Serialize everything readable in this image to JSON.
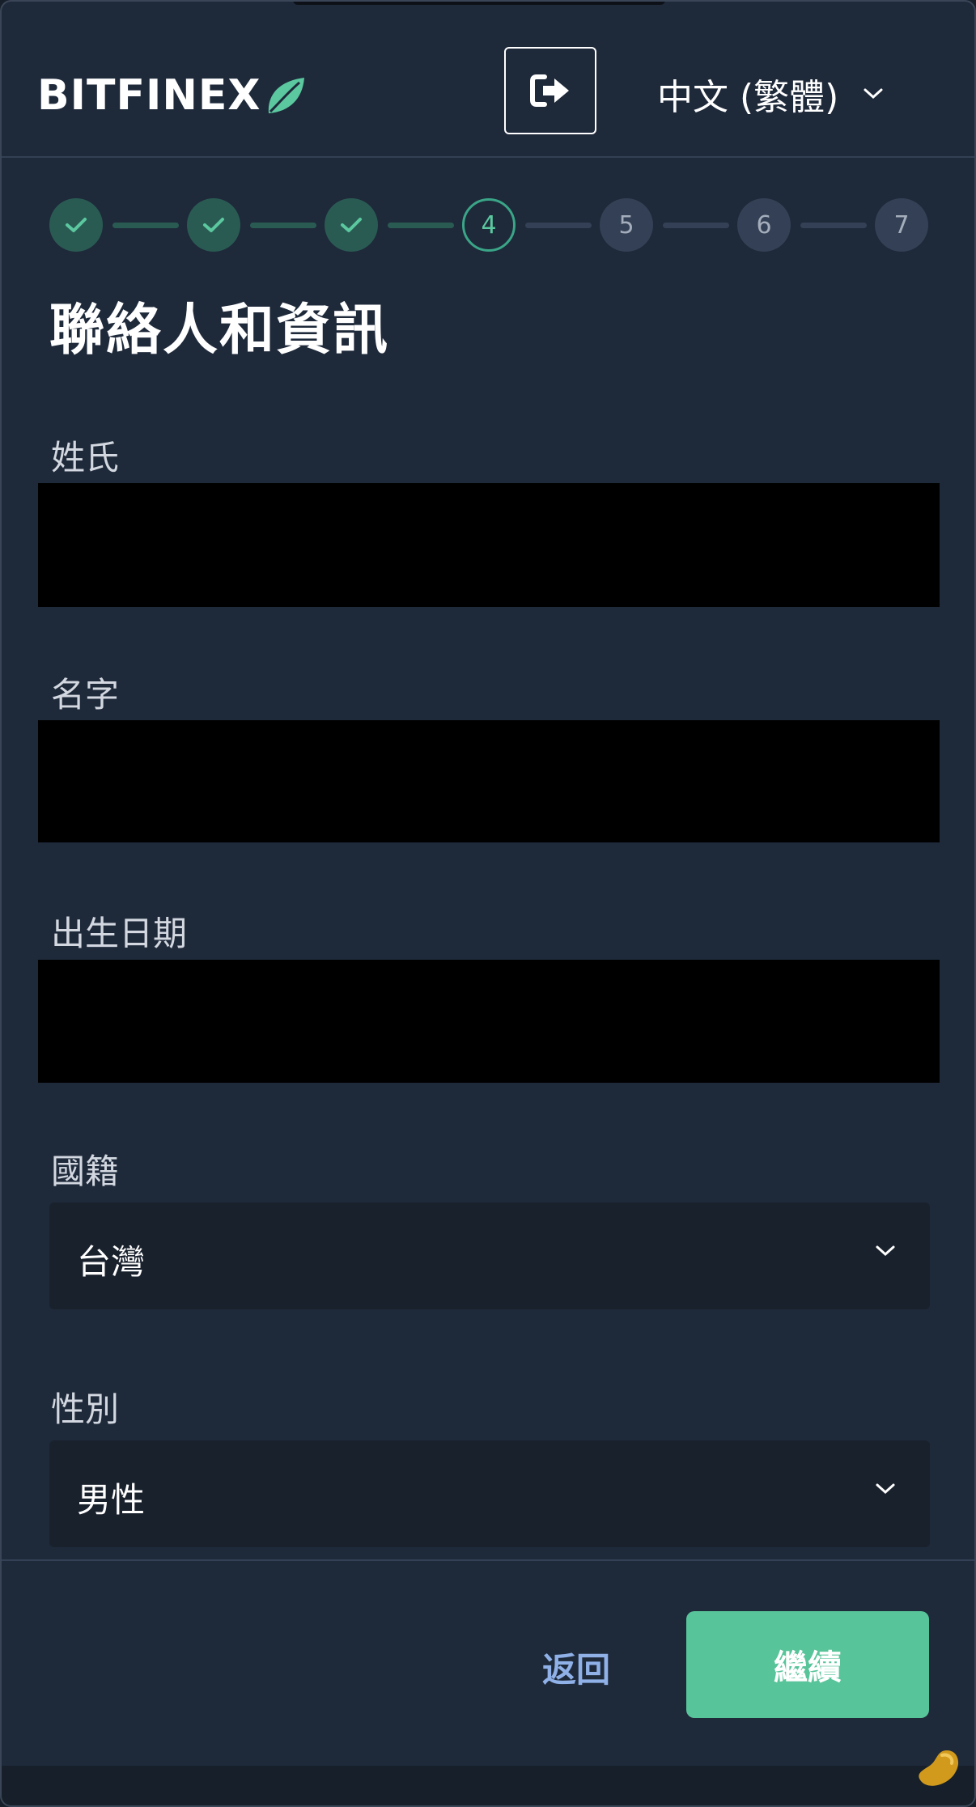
{
  "header": {
    "logo_text": "BITFINEX",
    "logout_icon": "sign-out-icon",
    "language": "中文 (繁體)",
    "language_icon": "chevron-down-icon"
  },
  "stepper": {
    "steps": [
      {
        "label": "",
        "state": "done"
      },
      {
        "label": "",
        "state": "done"
      },
      {
        "label": "",
        "state": "done"
      },
      {
        "label": "4",
        "state": "current"
      },
      {
        "label": "5",
        "state": "todo"
      },
      {
        "label": "6",
        "state": "todo"
      },
      {
        "label": "7",
        "state": "todo"
      }
    ]
  },
  "form": {
    "title": "聯絡人和資訊",
    "last_name_label": "姓氏",
    "first_name_label": "名字",
    "dob_label": "出生日期",
    "nationality_label": "國籍",
    "nationality_value": "台灣",
    "gender_label": "性別",
    "gender_value": "男性"
  },
  "footer": {
    "back_label": "返回",
    "continue_label": "繼續"
  },
  "colors": {
    "background": "#1e293a",
    "accent": "#58c49a",
    "link": "#8fb1e8"
  }
}
